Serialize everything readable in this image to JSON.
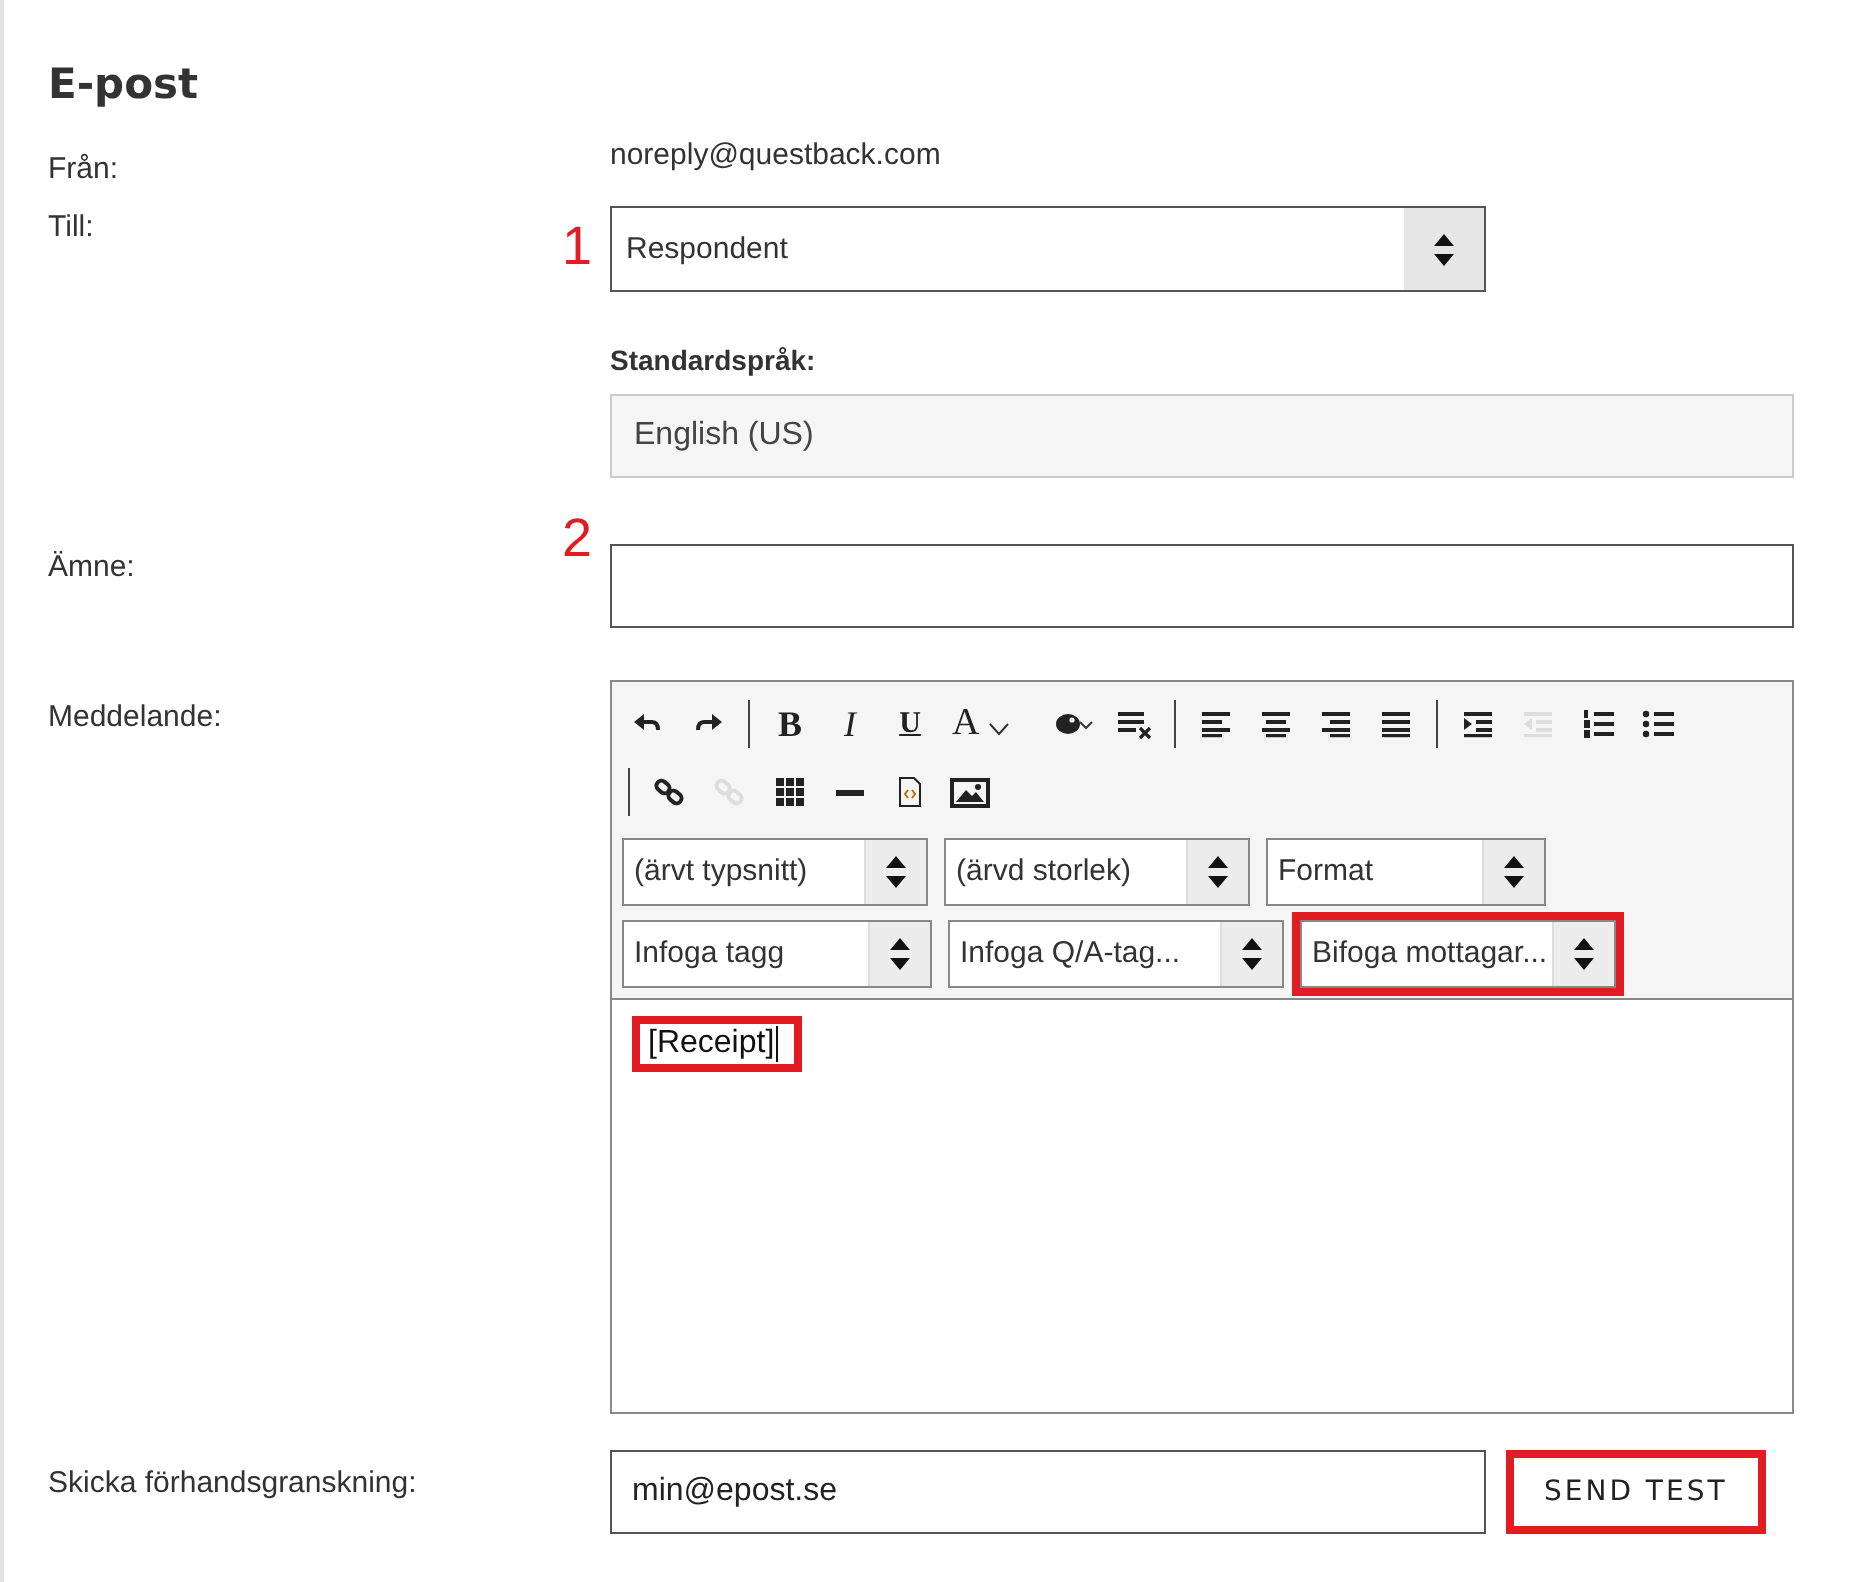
{
  "title": "E-post",
  "from": {
    "label": "Från:",
    "value": "noreply@questback.com"
  },
  "to": {
    "label": "Till:",
    "marker": "1",
    "value": "Respondent"
  },
  "language": {
    "label": "Standardspråk:",
    "value": "English (US)"
  },
  "subject": {
    "label": "Ämne:",
    "marker": "2"
  },
  "message": {
    "label": "Meddelande:",
    "toolbar_rows": [
      [
        {
          "kind": "undo",
          "disabled": false
        },
        {
          "kind": "redo",
          "disabled": false
        },
        {
          "kind": "separator"
        },
        {
          "kind": "bold",
          "label": "B",
          "disabled": false
        },
        {
          "kind": "italic",
          "label": "I",
          "disabled": false
        },
        {
          "kind": "underline",
          "label": "U",
          "disabled": false
        },
        {
          "kind": "textcolor",
          "label": "A",
          "disabled": false
        },
        {
          "kind": "palette",
          "disabled": false
        },
        {
          "kind": "clearformat",
          "disabled": false
        },
        {
          "kind": "separator"
        },
        {
          "kind": "alignleft",
          "disabled": false
        },
        {
          "kind": "aligncenter",
          "disabled": false
        },
        {
          "kind": "alignright",
          "disabled": false
        },
        {
          "kind": "justify",
          "disabled": false
        },
        {
          "kind": "separator"
        },
        {
          "kind": "indent",
          "disabled": false
        },
        {
          "kind": "outdent",
          "disabled": true
        },
        {
          "kind": "numlist",
          "disabled": false
        },
        {
          "kind": "bullist",
          "disabled": false
        }
      ],
      [
        {
          "kind": "separator"
        },
        {
          "kind": "link",
          "disabled": false
        },
        {
          "kind": "unlink",
          "disabled": true
        },
        {
          "kind": "table",
          "disabled": false
        },
        {
          "kind": "hr",
          "disabled": false
        },
        {
          "kind": "source",
          "disabled": false
        },
        {
          "kind": "image",
          "disabled": false
        }
      ]
    ],
    "dropdown_rows": [
      [
        {
          "value": "(ärvt typsnitt)",
          "highlighted": false
        },
        {
          "value": "(ärvd storlek)",
          "highlighted": false
        },
        {
          "value": "Format",
          "highlighted": false
        }
      ],
      [
        {
          "value": "Infoga tagg",
          "highlighted": false
        },
        {
          "value": "Infoga Q/A-tag...",
          "highlighted": false
        },
        {
          "value": "Bifoga mottagar...",
          "highlighted": true
        }
      ]
    ],
    "content": {
      "text": "[Receipt]",
      "highlighted": true
    }
  },
  "preview": {
    "label": "Skicka förhandsgranskning:",
    "value": "min@epost.se",
    "button": "SEND TEST",
    "button_highlighted": true
  }
}
